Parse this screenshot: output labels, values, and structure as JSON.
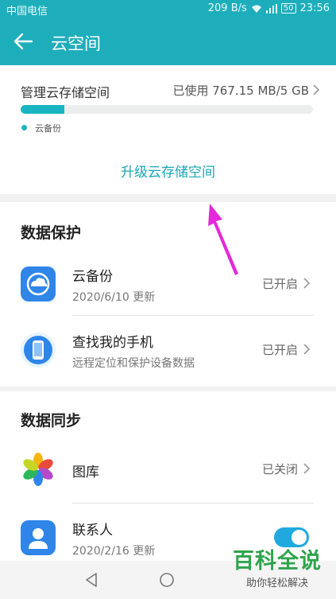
{
  "status_bar": {
    "carrier": "中国电信",
    "speed": "209 B/s",
    "battery": "50",
    "time": "23:56"
  },
  "header": {
    "title": "云空间"
  },
  "storage": {
    "label": "管理云存储空间",
    "used": "已使用 767.15 MB/5 GB",
    "used_fraction": 0.15,
    "legend": "云备份",
    "upgrade_label": "升级云存储空间"
  },
  "protection": {
    "title": "数据保护",
    "items": [
      {
        "name": "云备份",
        "sub": "2020/6/10 更新",
        "status": "已开启",
        "icon": "cloud-backup-icon"
      },
      {
        "name": "查找我的手机",
        "sub": "远程定位和保护设备数据",
        "status": "已开启",
        "icon": "find-phone-icon"
      }
    ]
  },
  "sync": {
    "title": "数据同步",
    "items": [
      {
        "name": "图库",
        "status": "已关闭",
        "icon": "gallery-icon"
      },
      {
        "name": "联系人",
        "sub": "2020/2/16 更新",
        "toggle_on": true,
        "icon": "contacts-icon"
      }
    ]
  },
  "watermark": {
    "title": "百科全说",
    "subtitle": "助你轻松解决"
  },
  "colors": {
    "accent": "#1eaebb",
    "toggle": "#1fa9df",
    "arrow": "#e22ad8"
  }
}
